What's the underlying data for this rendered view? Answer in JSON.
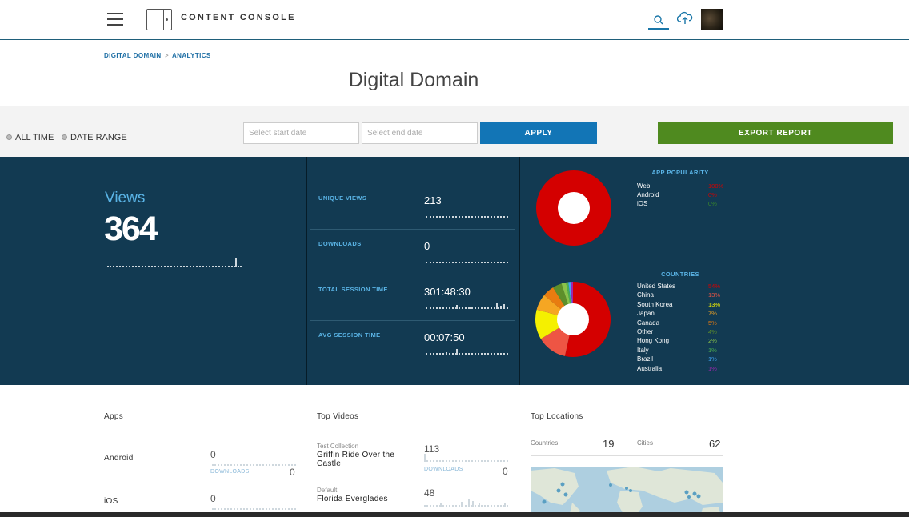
{
  "header": {
    "brand": "CONTENT CONSOLE",
    "icons": [
      "menu-icon",
      "logo-icon",
      "search-icon",
      "upload-cloud-icon",
      "avatar"
    ]
  },
  "breadcrumb": {
    "item1": "DIGITAL DOMAIN",
    "separator": ">",
    "item2": "ANALYTICS"
  },
  "page_title": "Digital Domain",
  "filters": {
    "all_time": "ALL TIME",
    "date_range": "DATE RANGE",
    "start_placeholder": "Select start date",
    "end_placeholder": "Select end date",
    "apply": "APPLY",
    "export": "EXPORT REPORT"
  },
  "stats": {
    "views_label": "Views",
    "views_value": "364",
    "metrics": [
      {
        "label": "UNIQUE VIEWS",
        "value": "213"
      },
      {
        "label": "DOWNLOADS",
        "value": "0"
      },
      {
        "label": "TOTAL SESSION TIME",
        "value": "301:48:30"
      },
      {
        "label": "AVG SESSION TIME",
        "value": "00:07:50"
      }
    ]
  },
  "app_popularity": {
    "title": "APP POPULARITY",
    "items": [
      {
        "name": "Web",
        "pct": "100%",
        "color": "#d40000"
      },
      {
        "name": "Android",
        "pct": "0%",
        "color": "#d40000"
      },
      {
        "name": "iOS",
        "pct": "0%",
        "color": "#3a8a2a"
      }
    ]
  },
  "countries": {
    "title": "COUNTRIES",
    "items": [
      {
        "name": "United States",
        "pct": "54%",
        "color": "#d40000"
      },
      {
        "name": "China",
        "pct": "13%",
        "color": "#ee5544"
      },
      {
        "name": "South Korea",
        "pct": "13%",
        "color": "#f5f000"
      },
      {
        "name": "Japan",
        "pct": "7%",
        "color": "#f5a623"
      },
      {
        "name": "Canada",
        "pct": "5%",
        "color": "#e87c10"
      },
      {
        "name": "Other",
        "pct": "4%",
        "color": "#5e8f2a"
      },
      {
        "name": "Hong Kong",
        "pct": "2%",
        "color": "#8bc34a"
      },
      {
        "name": "Italy",
        "pct": "1%",
        "color": "#4caf50"
      },
      {
        "name": "Brazil",
        "pct": "1%",
        "color": "#42a5f5"
      },
      {
        "name": "Australia",
        "pct": "1%",
        "color": "#9c27b0"
      }
    ]
  },
  "apps": {
    "title": "Apps",
    "rows": [
      {
        "name": "Android",
        "views": "0",
        "downloads_label": "DOWNLOADS",
        "downloads": "0"
      },
      {
        "name": "iOS",
        "views": "0"
      }
    ]
  },
  "top_videos": {
    "title": "Top Videos",
    "rows": [
      {
        "collection": "Test Collection",
        "title": "Griffin Ride Over the Castle",
        "views": "113",
        "downloads_label": "DOWNLOADS",
        "downloads": "0"
      },
      {
        "collection": "Default",
        "title": "Florida Everglades",
        "views": "48"
      }
    ]
  },
  "top_locations": {
    "title": "Top Locations",
    "countries_label": "Countries",
    "countries_value": "19",
    "cities_label": "Cities",
    "cities_value": "62"
  }
}
